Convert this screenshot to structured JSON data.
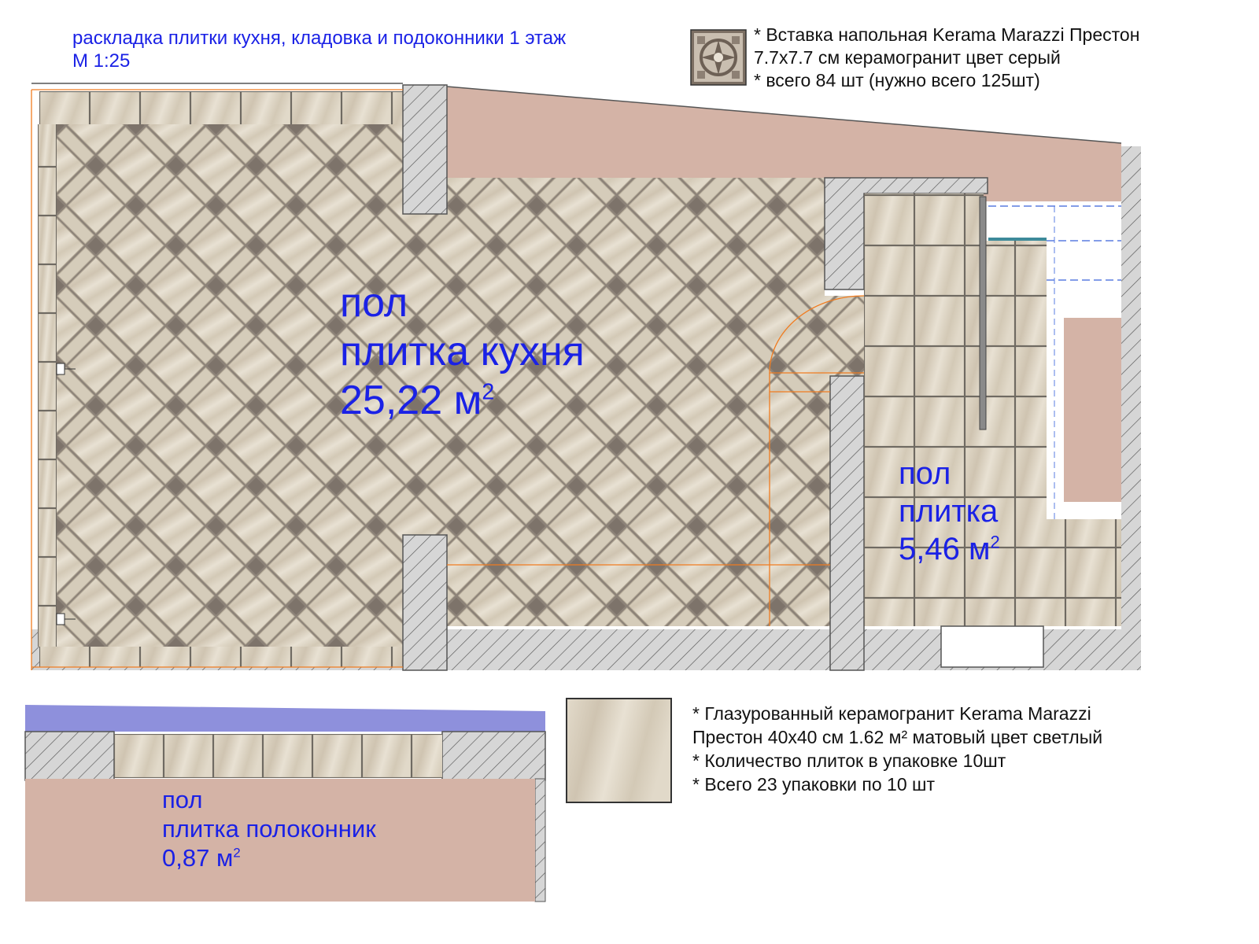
{
  "header": {
    "title_line1": "раскладка плитки кухня, кладовка и подоконники 1 этаж",
    "title_line2": "М 1:25"
  },
  "insert_note": {
    "line1": "* Вставка напольная Kerama Marazzi Престон",
    "line2": "7.7х7.7 см керамогранит цвет серый",
    "line3": "* всего 84 шт (нужно всего 125шт)"
  },
  "kitchen": {
    "line1": "пол",
    "line2": "плитка кухня",
    "area_value": "25,22 м",
    "area_exp": "2"
  },
  "pantry": {
    "line1": "пол",
    "line2": "плитка",
    "area_value": "5,46 м",
    "area_exp": "2"
  },
  "sill": {
    "line1": "пол",
    "line2": "плитка полоконник",
    "area_value": "0,87 м",
    "area_exp": "2"
  },
  "tile_note": {
    "line1": "* Глазурованный керамогранит Kerama Marazzi",
    "line2": "Престон 40х40 см 1.62 м² матовый цвет светлый",
    "line3": "* Количество плиток в упаковке 10шт",
    "line4": "* Всего 23 упаковки по 10 шт"
  },
  "colors": {
    "annotation_blue": "#1a21e6",
    "wall_pink": "#d4b3a6",
    "tile_beige": "#ddd4c3",
    "insert_gray": "#8c8278",
    "wall_gray": "#cdcdcd",
    "window_sill": "#8e90dc",
    "guide_orange": "#f07c20"
  },
  "icons": {
    "insert_swatch": "ornament-tile-swatch",
    "main_tile_swatch": "wood-grain-tile-swatch"
  }
}
